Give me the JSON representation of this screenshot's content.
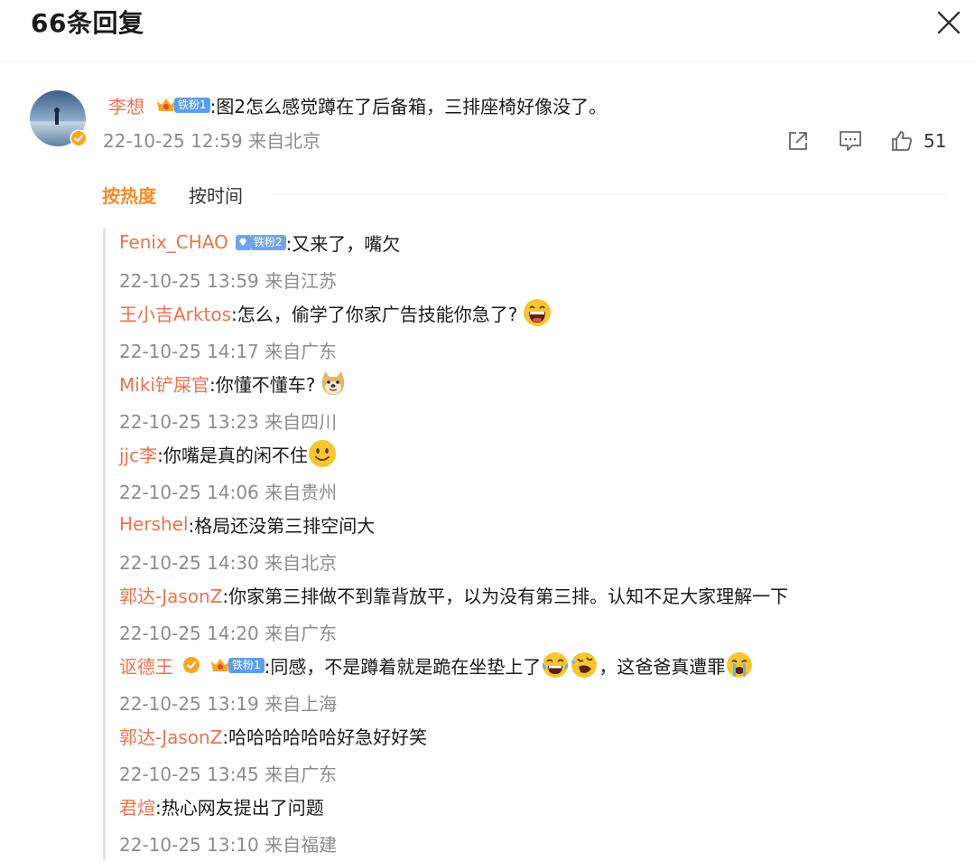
{
  "header": {
    "title": "66条回复"
  },
  "main_comment": {
    "user": "李想",
    "fan_level": "铁粉1",
    "text": ":图2怎么感觉蹲在了后备箱，三排座椅好像没了。",
    "meta": "22-10-25 12:59 来自北京",
    "likes": "51"
  },
  "sort": {
    "hot": "按热度",
    "time": "按时间"
  },
  "replies": [
    {
      "user": "Fenix_CHAO",
      "fan_level": "铁粉2",
      "text": ":又来了，嘴欠",
      "meta": "22-10-25 13:59 来自江苏"
    },
    {
      "user": "王小吉Arktos",
      "text": ":怎么，偷学了你家广告技能你急了?",
      "emoji": "laugh-emoji",
      "meta": "22-10-25 14:17 来自广东"
    },
    {
      "user": "Miki铲屎官",
      "text": ":你懂不懂车?",
      "emoji": "doge-emoji",
      "meta": "22-10-25 13:23 来自四川"
    },
    {
      "user": "jjc李",
      "text": ":你嘴是真的闲不住",
      "emoji": "smile-emoji",
      "meta": "22-10-25 14:06 来自贵州"
    },
    {
      "user": "Hershel",
      "text": ":格局还没第三排空间大",
      "meta": "22-10-25 14:30 来自北京"
    },
    {
      "user": "郭达-JasonZ",
      "text": ":你家第三排做不到靠背放平，以为没有第三排。认知不足大家理解一下",
      "meta": "22-10-25 14:20 来自广东"
    },
    {
      "user": "讴德王",
      "fan_level": "铁粉1",
      "text": ":同感，不是蹲着就是跪在坐垫上了",
      "text2": "，这爸爸真遭罪",
      "meta": "22-10-25 13:19 来自上海"
    },
    {
      "user": "郭达-JasonZ",
      "text": ":哈哈哈哈哈哈好急好好笑",
      "meta": "22-10-25 13:45 来自广东"
    },
    {
      "user": "君煊",
      "text": ":热心网友提出了问题",
      "meta": "22-10-25 13:10 来自福建"
    }
  ],
  "colors": {
    "username": "#eb7350",
    "sort_active": "#f7892a",
    "meta": "#8c8c8c",
    "fan_badge": "#5a9ef0"
  }
}
